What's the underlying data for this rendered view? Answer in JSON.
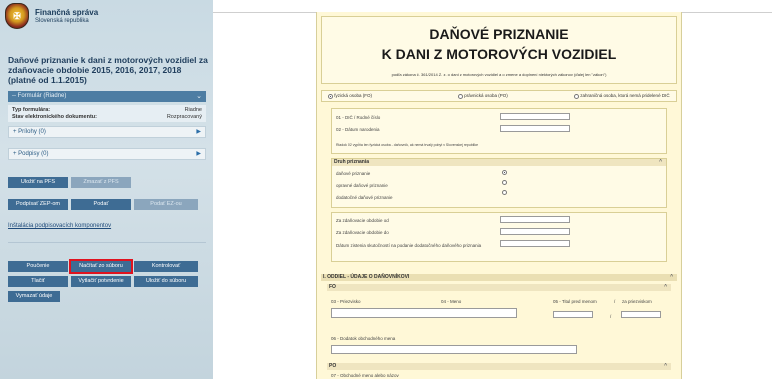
{
  "sidebar": {
    "org_name": "Finančná správa",
    "org_sub": "Slovenská republika",
    "form_title": "Daňové priznanie k dani z motorových vozidiel za zdaňovacie obdobie 2015, 2016, 2017, 2018 (platné od 1.1.2015)",
    "panel_header": "-- Formulár (Riadne)",
    "info": [
      {
        "key": "Typ formulára:",
        "value": "Riadne"
      },
      {
        "key": "Stav elektronického dokumentu:",
        "value": "Rozpracovaný"
      }
    ],
    "attachments": "+ Prílohy (0)",
    "signatures": "+ Podpisy (0)",
    "buttons_row1": [
      "Uložiť na PFS",
      "Zmazať z PFS"
    ],
    "buttons_row2": [
      "Podpísať ZEP-om",
      "Podať",
      "Podať EZ-ou"
    ],
    "install_link": "Inštalácia podpisovacích komponentov",
    "buttons_row3": [
      "Poučenie",
      "Načítať zo súboru",
      "Kontrolovať"
    ],
    "buttons_row4": [
      "Tlačiť",
      "Vytlačiť potvrdenie",
      "Uložiť do súboru"
    ],
    "buttons_row5": [
      "Vymazať údaje"
    ],
    "colors": {
      "primary_button": "#3e6c94",
      "highlight": "#e0131f"
    }
  },
  "form": {
    "title_line1": "DAŇOVÉ PRIZNANIE",
    "title_line2": "K DANI Z MOTOROVÝCH VOZIDIEL",
    "subtitle": "podľa zákona č. 361/2014 Z. z. o dani z motorových vozidiel a o zmene a doplnení niektorých zákonov (ďalej len \"zákon\")",
    "person_types": [
      "fyzická osoba (FO)",
      "právnická osoba (PO)",
      "zahraničná osoba, ktorá nemá pridelené DIČ"
    ],
    "field_dic": "01 - DIČ / Rodné číslo",
    "field_dob": "02 - Dátum narodenia",
    "note_dob": "Riadok 02 vypĺňa len fyzická osoba - daňovník, ak nemá trvalý pobyt v Slovenskej republike",
    "druh_header": "Druh priznania",
    "druh_options": [
      "daňové priznanie",
      "opravné daňové priznanie",
      "dodatočné daňové priznanie"
    ],
    "period_from": "Za zdaňovacie obdobie od",
    "period_to": "Za zdaňovacie obdobie do",
    "date_found": "Dátum zistenia skutočností na podanie dodatočného daňového priznania",
    "section1": "I. ODDIEL - ÚDAJE O DAŇOVNÍKOVI",
    "fo": "FO",
    "surname": "03 - Priezvisko",
    "name": "04 - Meno",
    "title_before": "05 - Titul pred menom",
    "title_sep": "/",
    "title_after": "za priezviskom",
    "trade_suffix": "06 - Dodatok obchodného mena",
    "po": "PO",
    "trade_name": "07 - Obchodné meno alebo názov"
  }
}
